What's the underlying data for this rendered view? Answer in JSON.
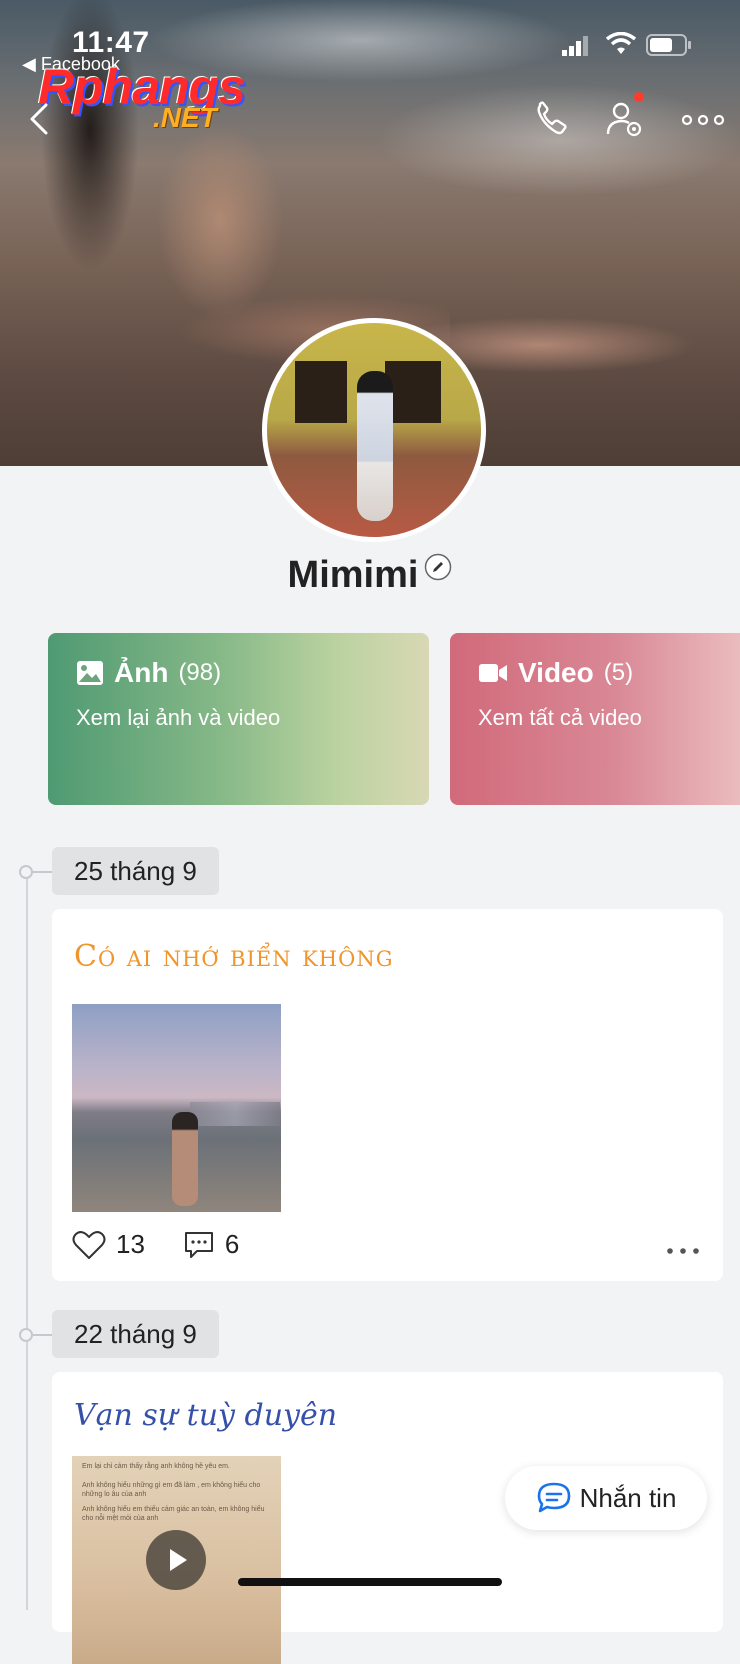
{
  "status_bar": {
    "time": "11:47",
    "back_app": "◀ Facebook"
  },
  "watermark": {
    "main": "Rphangs",
    "suffix": ".NET"
  },
  "profile": {
    "name": "Mimimi"
  },
  "cards": [
    {
      "title": "Ảnh",
      "count": "(98)",
      "subtitle": "Xem lại ảnh và video"
    },
    {
      "title": "Video",
      "count": "(5)",
      "subtitle": "Xem tất cả video"
    }
  ],
  "feed": [
    {
      "date": "25 tháng 9",
      "title": "Có ai nhớ biển không",
      "likes": "13",
      "comments": "6"
    },
    {
      "date": "22 tháng 9",
      "title": "Vạn sự tuỳ duyên",
      "image_text": [
        "Em lại chỉ cảm thấy rằng anh không hề yêu em.",
        "Anh không hiểu những gì em đã làm , em không hiểu cho những lo âu của anh",
        "Anh không hiểu em thiếu cảm giác an toàn, em không hiểu cho nỗi mệt mỏi của anh"
      ]
    }
  ],
  "message_button": {
    "label": "Nhắn tin"
  },
  "colors": {
    "accent_orange": "#f0952a",
    "accent_blue": "#3550a8",
    "card_green": "#4f9a72",
    "card_red": "#d16a7a",
    "msg_blue": "#1a73e8",
    "notif_red": "#ff3b30"
  }
}
